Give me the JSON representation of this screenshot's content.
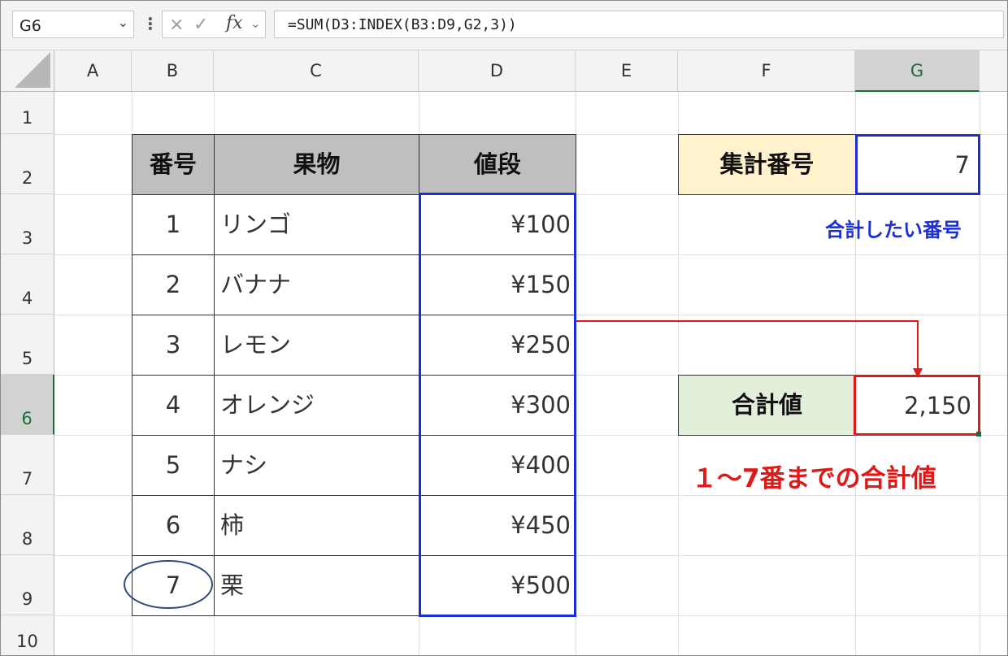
{
  "formula_bar": {
    "name_box": "G6",
    "cancel_icon": "×",
    "enter_icon": "✓",
    "fx_label": "fx",
    "formula": "=SUM(D3:INDEX(B3:D9,G2,3))"
  },
  "columns": [
    "A",
    "B",
    "C",
    "D",
    "E",
    "F",
    "G"
  ],
  "selected_column": "G",
  "rows": [
    "1",
    "2",
    "3",
    "4",
    "5",
    "6",
    "7",
    "8",
    "9",
    "10"
  ],
  "selected_row": "6",
  "table": {
    "headers": [
      "番号",
      "果物",
      "値段"
    ],
    "rows": [
      {
        "no": "1",
        "fruit": "リンゴ",
        "price": "¥100"
      },
      {
        "no": "2",
        "fruit": "バナナ",
        "price": "¥150"
      },
      {
        "no": "3",
        "fruit": "レモン",
        "price": "¥250"
      },
      {
        "no": "4",
        "fruit": "オレンジ",
        "price": "¥300"
      },
      {
        "no": "5",
        "fruit": "ナシ",
        "price": "¥400"
      },
      {
        "no": "6",
        "fruit": "柿",
        "price": "¥450"
      },
      {
        "no": "7",
        "fruit": "栗",
        "price": "¥500"
      }
    ]
  },
  "lookup": {
    "label": "集計番号",
    "value": "7",
    "note": "合計したい番号"
  },
  "result": {
    "label": "合計値",
    "value": "2,150",
    "note": "１～7番までの合計値"
  },
  "colors": {
    "blue_highlight": "#1c2fd6",
    "red_highlight": "#e01818",
    "lookup_label_bg": "#fff2cc",
    "result_label_bg": "#e2efda",
    "header_bg": "#bfbfbf",
    "circle": "#2f4b7c"
  }
}
